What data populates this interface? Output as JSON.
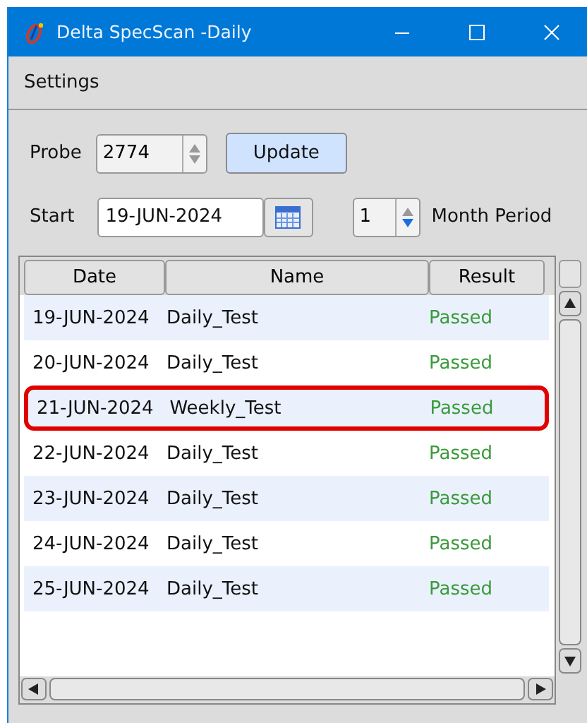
{
  "window": {
    "title": "Delta SpecScan -Daily"
  },
  "menu": [
    "Settings"
  ],
  "probe": {
    "label": "Probe",
    "value": "2774"
  },
  "update_button": "Update",
  "start": {
    "label": "Start",
    "value": "19-JUN-2024"
  },
  "period": {
    "value": "1",
    "label": "Month Period"
  },
  "table": {
    "columns": [
      "Date",
      "Name",
      "Result"
    ],
    "rows": [
      {
        "date": "19-JUN-2024",
        "name": "Daily_Test",
        "result": "Passed",
        "highlighted": false
      },
      {
        "date": "20-JUN-2024",
        "name": "Daily_Test",
        "result": "Passed",
        "highlighted": false
      },
      {
        "date": "21-JUN-2024",
        "name": "Weekly_Test",
        "result": "Passed",
        "highlighted": true
      },
      {
        "date": "22-JUN-2024",
        "name": "Daily_Test",
        "result": "Passed",
        "highlighted": false
      },
      {
        "date": "23-JUN-2024",
        "name": "Daily_Test",
        "result": "Passed",
        "highlighted": false
      },
      {
        "date": "24-JUN-2024",
        "name": "Daily_Test",
        "result": "Passed",
        "highlighted": false
      },
      {
        "date": "25-JUN-2024",
        "name": "Daily_Test",
        "result": "Passed",
        "highlighted": false
      }
    ]
  }
}
